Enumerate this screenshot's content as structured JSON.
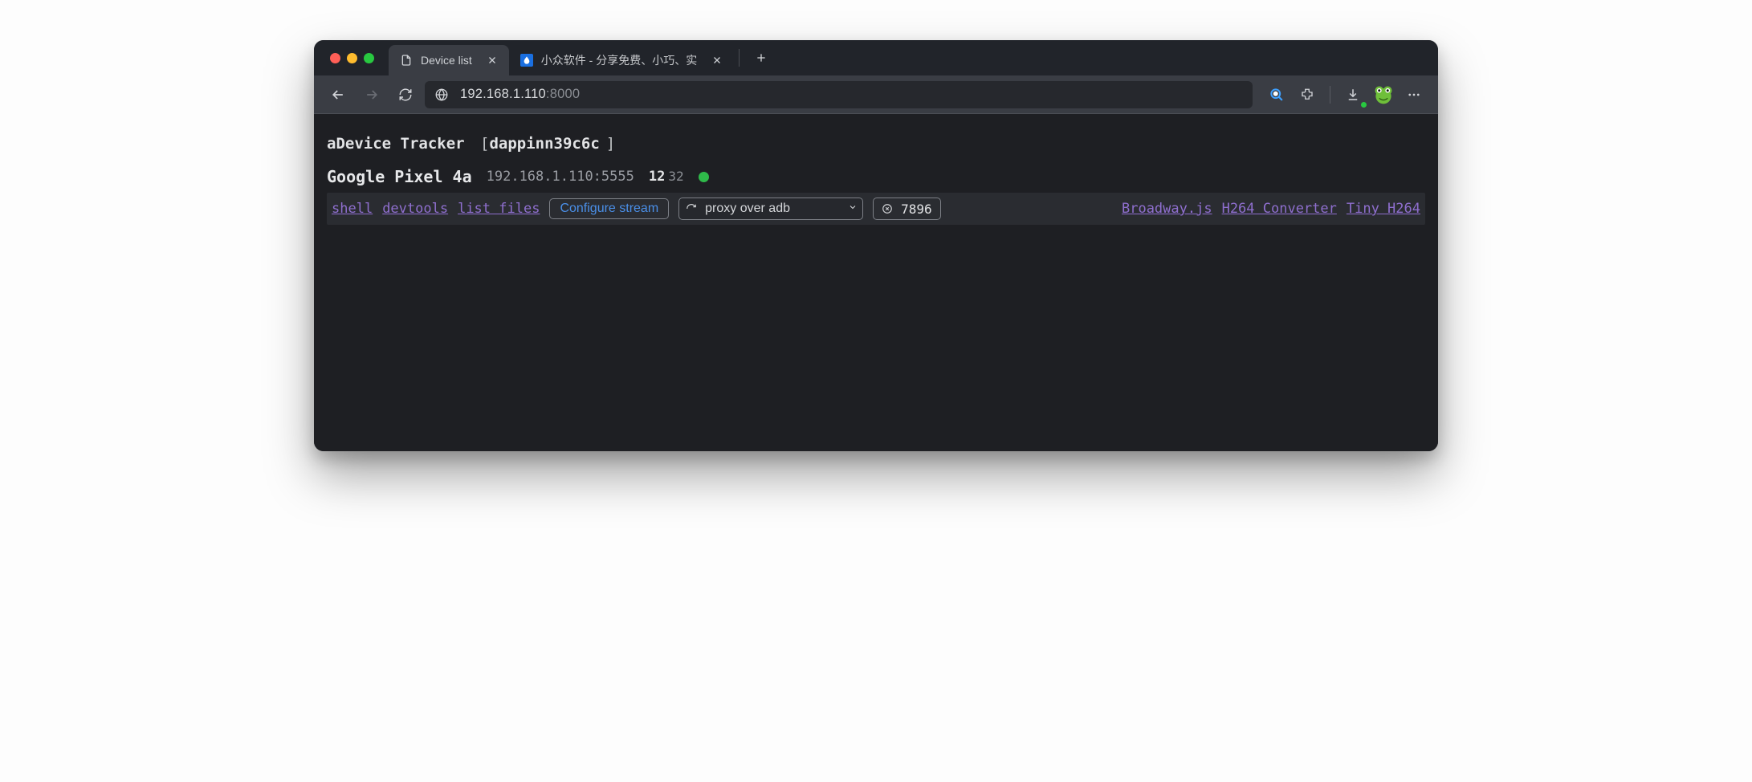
{
  "tabs": {
    "active": {
      "title": "Device list"
    },
    "inactive": {
      "title": "小众软件 - 分享免费、小巧、实"
    }
  },
  "url": {
    "host": "192.168.1.110",
    "port": ":8000"
  },
  "page": {
    "app_name": "aDevice Tracker",
    "instance_id": "dappinn39c6c"
  },
  "device": {
    "name": "Google Pixel 4a",
    "address": "192.168.1.110:5555",
    "version_major": "12",
    "version_minor": "32"
  },
  "links": {
    "shell": "shell",
    "devtools": "devtools",
    "list_files": "list files"
  },
  "buttons": {
    "configure": "Configure stream"
  },
  "select": {
    "value": "proxy over adb"
  },
  "port": {
    "value": "7896"
  },
  "decoders": {
    "broadway": "Broadway.js",
    "h264conv": "H264 Converter",
    "tinyh264": "Tiny H264"
  }
}
